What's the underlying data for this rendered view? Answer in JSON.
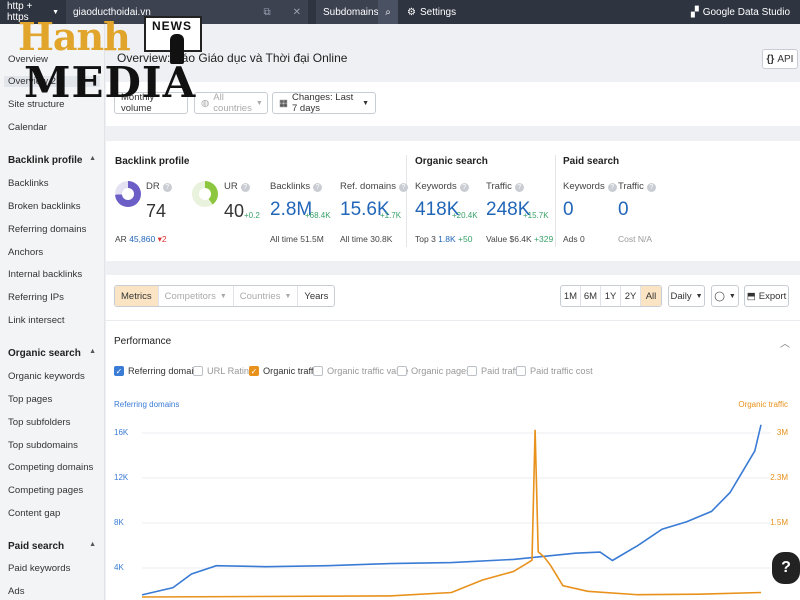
{
  "topbar": {
    "protocol": "http + https",
    "url": "giaoducthoidai.vn",
    "mode": "Subdomains",
    "settings": "Settings",
    "gds": "Google Data Studio"
  },
  "logo": {
    "hanh": "Hanh",
    "news": "NEWS",
    "media": "MEDIA"
  },
  "sidebar": {
    "top_items": [
      "Overview",
      "Overview 2.0",
      "Site structure",
      "Calendar"
    ],
    "sections": [
      {
        "title": "Backlink profile",
        "items": [
          "Backlinks",
          "Broken backlinks",
          "Referring domains",
          "Anchors",
          "Internal backlinks",
          "Referring IPs",
          "Link intersect"
        ]
      },
      {
        "title": "Organic search",
        "items": [
          "Organic keywords",
          "Top pages",
          "Top subfolders",
          "Top subdomains",
          "Competing domains",
          "Competing pages",
          "Content gap"
        ]
      },
      {
        "title": "Paid search",
        "items": [
          "Paid keywords",
          "Ads"
        ]
      }
    ]
  },
  "header": {
    "title": "Overview: Báo Giáo dục và Thời đại Online",
    "api": "API"
  },
  "filters": {
    "volume": "Monthly volume",
    "country": "All countries",
    "changes": "Changes: Last 7 days"
  },
  "stats": {
    "backlink_title": "Backlink profile",
    "organic_title": "Organic search",
    "paid_title": "Paid search",
    "dr": {
      "label": "DR",
      "value": "74",
      "ar_label": "AR",
      "ar_value": "45,860",
      "ar_delta": "▾2"
    },
    "ur": {
      "label": "UR",
      "value": "40",
      "delta": "+0.2"
    },
    "backlinks": {
      "label": "Backlinks",
      "value": "2.8M",
      "delta": "+68.4K",
      "sub": "All time 51.5M"
    },
    "ref_domains": {
      "label": "Ref. domains",
      "value": "15.6K",
      "delta": "+1.7K",
      "sub": "All time 30.8K"
    },
    "keywords": {
      "label": "Keywords",
      "value": "418K",
      "delta": "+20.4K",
      "sub_label": "Top 3",
      "sub_value": "1.8K",
      "sub_delta": "+50"
    },
    "traffic": {
      "label": "Traffic",
      "value": "248K",
      "delta": "+15.7K",
      "sub_label": "Value",
      "sub_value": "$6.4K",
      "sub_delta": "+329"
    },
    "paid_keywords": {
      "label": "Keywords",
      "value": "0",
      "sub": "Ads 0"
    },
    "paid_traffic": {
      "label": "Traffic",
      "value": "0",
      "sub": "Cost N/A"
    }
  },
  "chart_panel": {
    "tabs": [
      "Metrics",
      "Competitors",
      "Countries",
      "Years"
    ],
    "ranges": [
      "1M",
      "6M",
      "1Y",
      "2Y",
      "All"
    ],
    "interval": "Daily",
    "export": "Export",
    "performance": "Performance",
    "legend": [
      {
        "label": "Referring domains",
        "checked": true,
        "color": "#3a7bd5"
      },
      {
        "label": "URL Rating",
        "checked": false
      },
      {
        "label": "Organic traffic",
        "checked": true,
        "color": "#e8911b"
      },
      {
        "label": "Organic traffic value",
        "checked": false
      },
      {
        "label": "Organic pages",
        "checked": false
      },
      {
        "label": "Paid traffic",
        "checked": false
      },
      {
        "label": "Paid traffic cost",
        "checked": false
      }
    ]
  },
  "chart_data": {
    "type": "line",
    "left_axis_label": "Referring domains",
    "right_axis_label": "Organic traffic",
    "left_ticks": [
      "16K",
      "12K",
      "8K",
      "4K"
    ],
    "right_ticks": [
      "3M",
      "2.3M",
      "1.5M"
    ],
    "left_ylim": [
      0,
      16000
    ],
    "right_ylim": [
      0,
      3000000
    ],
    "series": [
      {
        "name": "Referring domains",
        "color": "#3a7bd5",
        "points": [
          [
            0,
            200
          ],
          [
            5,
            900
          ],
          [
            8,
            2200
          ],
          [
            12,
            3000
          ],
          [
            20,
            2900
          ],
          [
            30,
            3000
          ],
          [
            40,
            3200
          ],
          [
            50,
            3300
          ],
          [
            60,
            3600
          ],
          [
            65,
            3900
          ],
          [
            70,
            4200
          ],
          [
            74,
            4300
          ],
          [
            76,
            3500
          ],
          [
            80,
            4900
          ],
          [
            84,
            6500
          ],
          [
            88,
            7200
          ],
          [
            92,
            8200
          ],
          [
            95,
            10000
          ],
          [
            97,
            12000
          ],
          [
            99,
            14000
          ],
          [
            100,
            16500
          ]
        ]
      },
      {
        "name": "Organic traffic",
        "color": "#e8911b",
        "points": [
          [
            0,
            0
          ],
          [
            40,
            20000
          ],
          [
            50,
            80000
          ],
          [
            55,
            300000
          ],
          [
            60,
            450000
          ],
          [
            62,
            580000
          ],
          [
            63,
            650000
          ],
          [
            63.5,
            2950000
          ],
          [
            64,
            800000
          ],
          [
            65,
            700000
          ],
          [
            66,
            560000
          ],
          [
            68,
            200000
          ],
          [
            72,
            100000
          ],
          [
            80,
            40000
          ],
          [
            90,
            50000
          ],
          [
            100,
            80000
          ]
        ]
      }
    ]
  }
}
